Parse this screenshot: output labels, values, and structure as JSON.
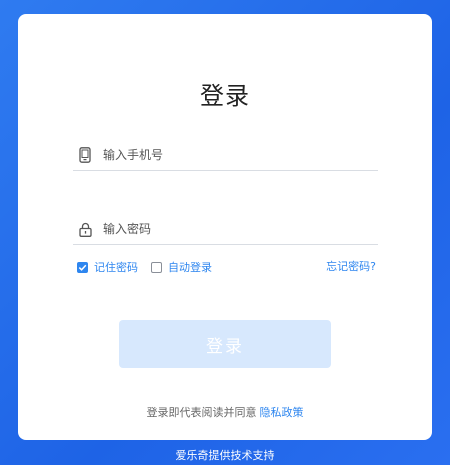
{
  "login": {
    "title": "登录",
    "phone_placeholder": "输入手机号",
    "password_placeholder": "输入密码",
    "remember_label": "记住密码",
    "remember_checked": true,
    "auto_login_label": "自动登录",
    "auto_login_checked": false,
    "forgot_label": "忘记密码?",
    "submit_label": "登录",
    "agreement_text": "登录即代表阅读并同意",
    "privacy_link": "隐私政策"
  },
  "footer": {
    "text": "爱乐奇提供技术支持"
  },
  "colors": {
    "accent": "#2e86ef",
    "background": "#1e63e6",
    "button_disabled": "#d7e8fd"
  },
  "icons": {
    "phone": "mobile-phone-icon",
    "password": "lock-icon",
    "checkbox": "check-icon"
  }
}
